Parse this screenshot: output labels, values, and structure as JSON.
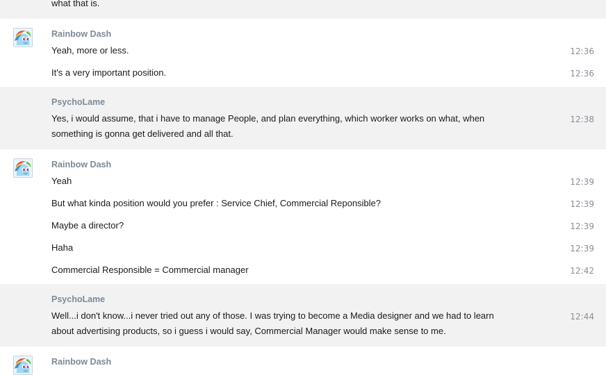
{
  "groups": [
    {
      "sender": "",
      "messages": [
        {
          "text": "what that is.",
          "time": ""
        }
      ]
    },
    {
      "sender": "Rainbow Dash",
      "avatar_icon": "rainbow-dash-pony-avatar",
      "messages": [
        {
          "text": "Yeah, more or less.",
          "time": "12:36"
        },
        {
          "text": "It's a very important position.",
          "time": "12:36"
        }
      ]
    },
    {
      "sender": "PsychoLame",
      "messages": [
        {
          "text": "Yes, i would assume, that i have to manage People, and plan everything, which worker works on what, when something is gonna get delivered and all that.",
          "time": "12:38"
        }
      ]
    },
    {
      "sender": "Rainbow Dash",
      "avatar_icon": "rainbow-dash-pony-avatar",
      "messages": [
        {
          "text": "Yeah",
          "time": "12:39"
        },
        {
          "text": "But what kinda position would you prefer : Service Chief, Commercial Reponsible?",
          "time": "12:39"
        },
        {
          "text": "Maybe a director?",
          "time": "12:39"
        },
        {
          "text": "Haha",
          "time": "12:39"
        },
        {
          "text": "Commercial Responsible = Commercial manager",
          "time": "12:42"
        }
      ]
    },
    {
      "sender": "PsychoLame",
      "messages": [
        {
          "text": "Well...i don't know...i never tried out any of those. I was trying to become a Media designer and we had to learn about advertising products, so i guess i would say, Commercial Manager would make sense to me.",
          "time": "12:44"
        }
      ]
    },
    {
      "sender": "Rainbow Dash",
      "avatar_icon": "rainbow-dash-pony-avatar",
      "messages": []
    }
  ],
  "colors": {
    "alt_background": "#f2f2f2",
    "sender_name": "#7d8a97",
    "timestamp": "#8a8f96",
    "avatar_hair_red": "#e6453c",
    "avatar_hair_yellow": "#f7d34a",
    "avatar_hair_blue": "#3d8fd6",
    "avatar_coat": "#9fd8f2"
  }
}
